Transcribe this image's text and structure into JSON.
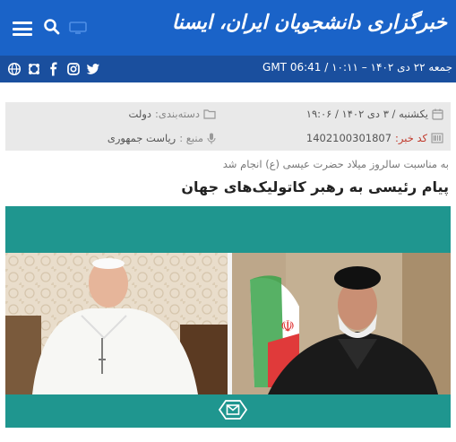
{
  "header": {
    "logo_text": "خبرگزاری دانشجویان ایران، ایسنا"
  },
  "subbar": {
    "datetime": "جمعه ۲۲ دی ۱۴۰۲ – ۱۰:۱۱ / GMT 06:41",
    "social_icons": [
      "globe-icon",
      "aparat-icon",
      "facebook-icon",
      "instagram-icon",
      "twitter-icon"
    ]
  },
  "meta": {
    "date_text": "یکشنبه / ۳ دی ۱۴۰۲ / ۱۹:۰۶",
    "category_label": "دسته‌بندی:",
    "category_value": "دولت",
    "code_label": "کد خبر:",
    "code_value": "1402100301807",
    "source_label": "منبع :",
    "source_value": "ریاست جمهوری"
  },
  "article": {
    "lead": "به مناسبت سالروز میلاد حضرت عیسی (ع) انجام شد",
    "title": "پیام رئیسی به رهبر کاتولیک‌های جهان"
  },
  "colors": {
    "header_blue": "#1a63c8",
    "subbar_blue": "#1a4f9e",
    "teal": "#1f968f",
    "meta_bg": "#e9e9e9",
    "code_red": "#c0392b"
  }
}
